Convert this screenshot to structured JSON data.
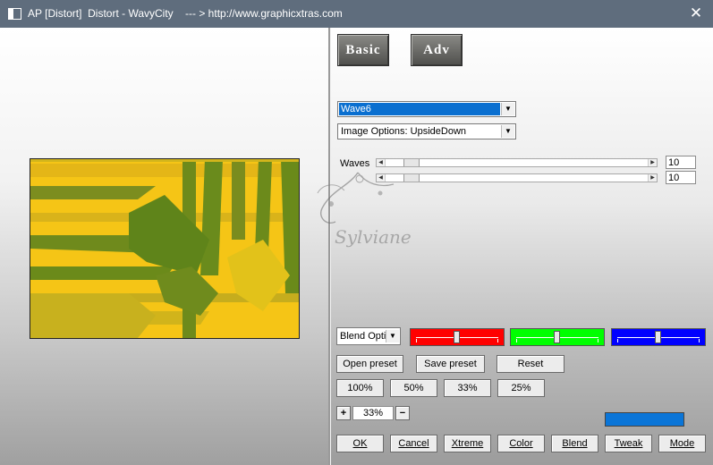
{
  "window": {
    "title": "AP [Distort]  Distort - WavyCity    --- > http://www.graphicxtras.com",
    "close_label": "✕"
  },
  "tabs": {
    "basic": "Basic",
    "adv": "Adv"
  },
  "effect_select": {
    "value": "Wave6"
  },
  "image_options_select": {
    "value": "Image Options: UpsideDown"
  },
  "waves": {
    "label": "Waves",
    "slider1_value": "10",
    "slider2_value": "10"
  },
  "blend_select": {
    "value": "Blend Optio"
  },
  "colors": {
    "red": "#ff0000",
    "green": "#00ff00",
    "blue": "#0000ff",
    "blue_bar": "#0a75d8"
  },
  "watermark_text": "Sylviane",
  "buttons": {
    "open_preset": "Open preset",
    "save_preset": "Save preset",
    "reset": "Reset",
    "zoom_100": "100%",
    "zoom_50": "50%",
    "zoom_33": "33%",
    "zoom_25": "25%",
    "plus": "+",
    "minus": "−",
    "zoom_value": "33%",
    "ok": "OK",
    "cancel": "Cancel",
    "xtreme": "Xtreme",
    "color": "Color",
    "blend": "Blend",
    "tweak": "Tweak",
    "mode": "Mode"
  }
}
